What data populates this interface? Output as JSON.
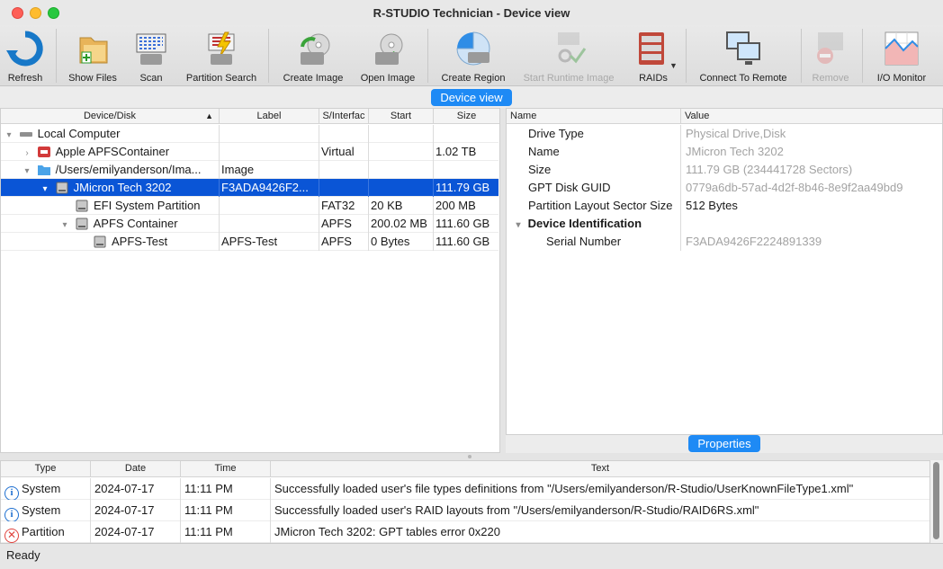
{
  "window": {
    "title": "R-STUDIO Technician - Device view"
  },
  "toolbar": {
    "refresh": "Refresh",
    "show_files": "Show Files",
    "scan": "Scan",
    "partition_search": "Partition Search",
    "create_image": "Create Image",
    "open_image": "Open Image",
    "create_region": "Create Region",
    "start_runtime_image": "Start Runtime Image",
    "raids": "RAIDs",
    "connect_to_remote": "Connect To Remote",
    "remove": "Remove",
    "io_monitor": "I/O Monitor"
  },
  "device_view": {
    "section_label": "Device view",
    "columns": [
      "Device/Disk",
      "Label",
      "S/Interfac",
      "Start",
      "Size"
    ],
    "rows": [
      {
        "name": "Local Computer",
        "label": "",
        "fs": "",
        "start": "",
        "size": ""
      },
      {
        "name": "Apple APFSContainer",
        "label": "",
        "fs": "Virtual",
        "start": "",
        "size": "1.02 TB"
      },
      {
        "name": "/Users/emilyanderson/Ima...",
        "label": "Image",
        "fs": "",
        "start": "",
        "size": ""
      },
      {
        "name": "JMicron Tech 3202",
        "label": "F3ADA9426F2...",
        "fs": "",
        "start": "",
        "size": "111.79 GB"
      },
      {
        "name": "EFI System Partition",
        "label": "",
        "fs": "FAT32",
        "start": "20 KB",
        "size": "200 MB"
      },
      {
        "name": "APFS Container",
        "label": "",
        "fs": "APFS",
        "start": "200.02 MB",
        "size": "111.60 GB"
      },
      {
        "name": "APFS-Test",
        "label": "APFS-Test",
        "fs": "APFS",
        "start": "0 Bytes",
        "size": "111.60 GB"
      }
    ]
  },
  "properties": {
    "section_label": "Properties",
    "columns": [
      "Name",
      "Value"
    ],
    "rows": [
      {
        "name": "Drive Type",
        "value": "Physical Drive,Disk"
      },
      {
        "name": "Name",
        "value": "JMicron Tech 3202"
      },
      {
        "name": "Size",
        "value": "111.79 GB (234441728 Sectors)"
      },
      {
        "name": "GPT Disk GUID",
        "value": "0779a6db-57ad-4d2f-8b46-8e9f2aa49bd9"
      },
      {
        "name": "Partition Layout Sector Size",
        "value": "512 Bytes"
      },
      {
        "name": "Device Identification",
        "value": ""
      },
      {
        "name": "Serial Number",
        "value": "F3ADA9426F2224891339"
      }
    ]
  },
  "log": {
    "columns": [
      "Type",
      "Date",
      "Time",
      "Text"
    ],
    "rows": [
      {
        "type": "System",
        "date": "2024-07-17",
        "time": "11:11 PM",
        "text": "Successfully loaded user's file types definitions from \"/Users/emilyanderson/R-Studio/UserKnownFileType1.xml\""
      },
      {
        "type": "System",
        "date": "2024-07-17",
        "time": "11:11 PM",
        "text": "Successfully loaded user's RAID layouts from \"/Users/emilyanderson/R-Studio/RAID6RS.xml\""
      },
      {
        "type": "Partition",
        "date": "2024-07-17",
        "time": "11:11 PM",
        "text": "JMicron Tech 3202: GPT tables error 0x220"
      }
    ]
  },
  "status": {
    "text": "Ready"
  },
  "colors": {
    "accent": "#1e8af5",
    "selection": "#0a55d6",
    "error": "#e0443e"
  }
}
